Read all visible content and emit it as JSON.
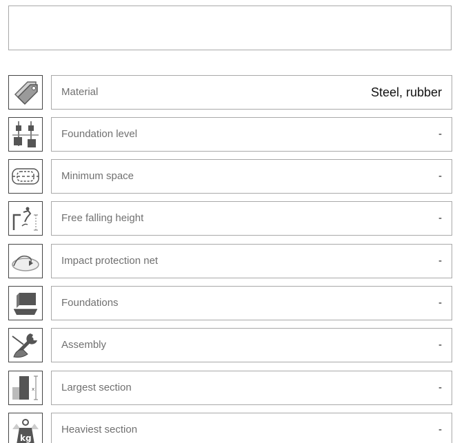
{
  "header": {
    "content": ""
  },
  "properties": [
    {
      "icon": "price-tag-icon",
      "label": "Material",
      "value": "Steel, rubber"
    },
    {
      "icon": "foundation-level-icon",
      "label": "Foundation level",
      "value": "-"
    },
    {
      "icon": "minimum-space-icon",
      "label": "Minimum space",
      "value": "-"
    },
    {
      "icon": "free-falling-height-icon",
      "label": "Free falling height",
      "value": "-"
    },
    {
      "icon": "impact-protection-net-icon",
      "label": "Impact protection net",
      "value": "-"
    },
    {
      "icon": "foundations-icon",
      "label": "Foundations",
      "value": "-"
    },
    {
      "icon": "assembly-wrench-icon",
      "label": "Assembly",
      "value": "-"
    },
    {
      "icon": "largest-section-icon",
      "label": "Largest section",
      "value": "-"
    },
    {
      "icon": "heaviest-section-kg-icon",
      "label": "Heaviest section",
      "value": "-",
      "icon_text": "kg"
    }
  ],
  "colors": {
    "border_light": "#a8a8a8",
    "border_dark": "#444444",
    "label_text": "#707070",
    "value_text": "#1a1a1a"
  }
}
